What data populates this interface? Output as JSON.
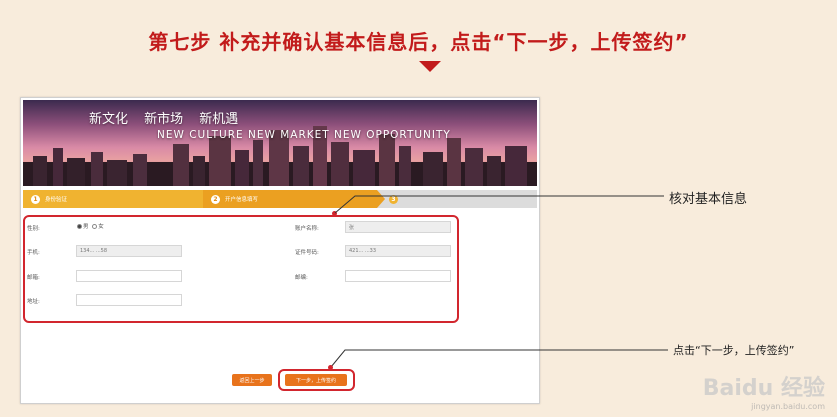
{
  "headline": "第七步 补充并确认基本信息后，点击“下一步，上传签约”",
  "banner": {
    "tagline_cn": "新文化 新市场 新机遇",
    "tagline_en": "NEW CULTURE NEW MARKET NEW OPPORTUNITY"
  },
  "steps": [
    {
      "num": "1",
      "label": "身份验证"
    },
    {
      "num": "2",
      "label": "开户信息填写"
    },
    {
      "num": "3",
      "label": ""
    }
  ],
  "form": {
    "gender_label": "性别:",
    "gender_options": [
      "男",
      "女"
    ],
    "gender_selected": "男",
    "phone_label": "手机:",
    "phone_value": "134... ...58",
    "email_label": "邮箱:",
    "email_value": "",
    "address_label": "地址:",
    "address_value": "",
    "account_name_label": "账户名称:",
    "account_name_value": "张",
    "id_number_label": "证件号码:",
    "id_number_value": "421... ...33",
    "postcode_label": "邮编:",
    "postcode_value": ""
  },
  "buttons": {
    "back": "返回上一步",
    "next": "下一步，上传签约"
  },
  "callouts": {
    "verify": "核对基本信息",
    "next": "点击“下一步，上传签约”"
  },
  "watermark": {
    "brand": "Baidu 经验",
    "url": "jingyan.baidu.com"
  },
  "colors": {
    "headline": "#c21b1b",
    "highlight": "#d2262e",
    "step_active": "#f0b330",
    "button": "#e8731c",
    "background": "#f8ecdc"
  }
}
